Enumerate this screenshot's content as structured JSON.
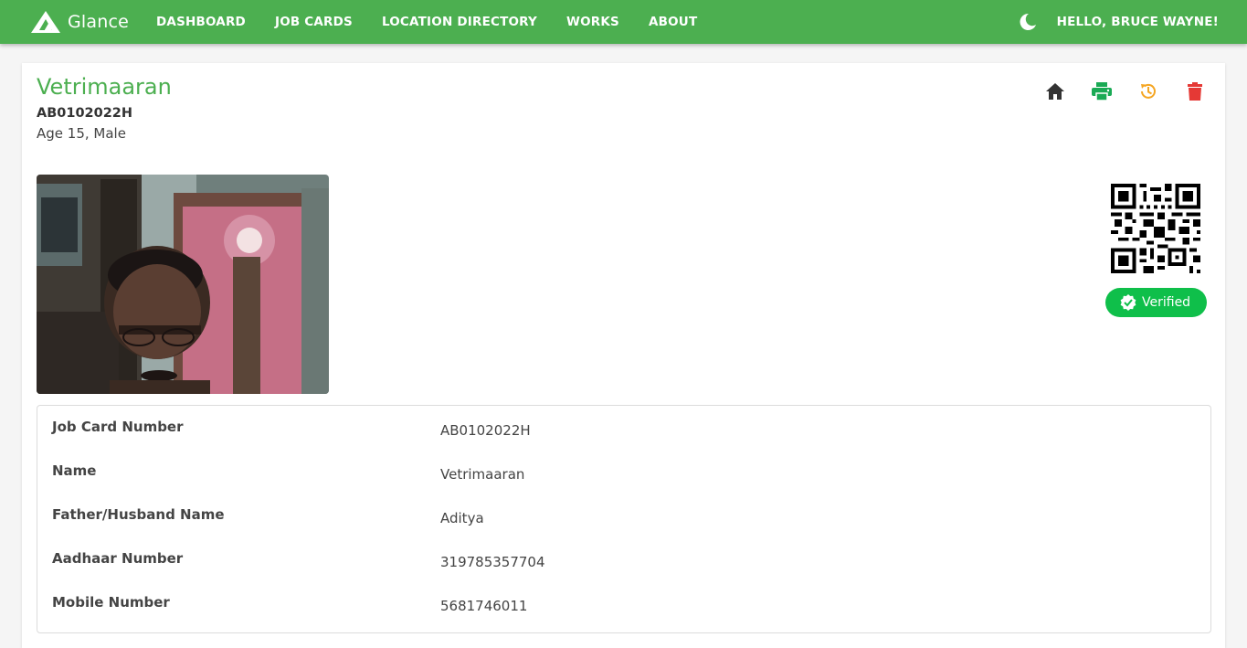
{
  "nav": {
    "brand": "Glance",
    "items": [
      "DASHBOARD",
      "JOB CARDS",
      "LOCATION DIRECTORY",
      "WORKS",
      "ABOUT"
    ],
    "greeting": "HELLO, BRUCE WAYNE!",
    "theme_icon": "moon-icon"
  },
  "profile": {
    "name": "Vetrimaaran",
    "job_card_number": "AB0102022H",
    "age_gender": "Age 15, Male",
    "verified_label": "Verified"
  },
  "actions": [
    {
      "icon": "home-icon",
      "color": "#333333"
    },
    {
      "icon": "print-icon",
      "color": "#1aaa55"
    },
    {
      "icon": "history-icon",
      "color": "#f5a623"
    },
    {
      "icon": "delete-icon",
      "color": "#e53935"
    }
  ],
  "details": [
    {
      "label": "Job Card Number",
      "value": "AB0102022H"
    },
    {
      "label": "Name",
      "value": "Vetrimaaran"
    },
    {
      "label": "Father/Husband Name",
      "value": "Aditya"
    },
    {
      "label": "Aadhaar Number",
      "value": "319785357704"
    },
    {
      "label": "Mobile Number",
      "value": "5681746011"
    }
  ],
  "colors": {
    "primary": "#4caf50",
    "verified": "#0fbf4a"
  }
}
